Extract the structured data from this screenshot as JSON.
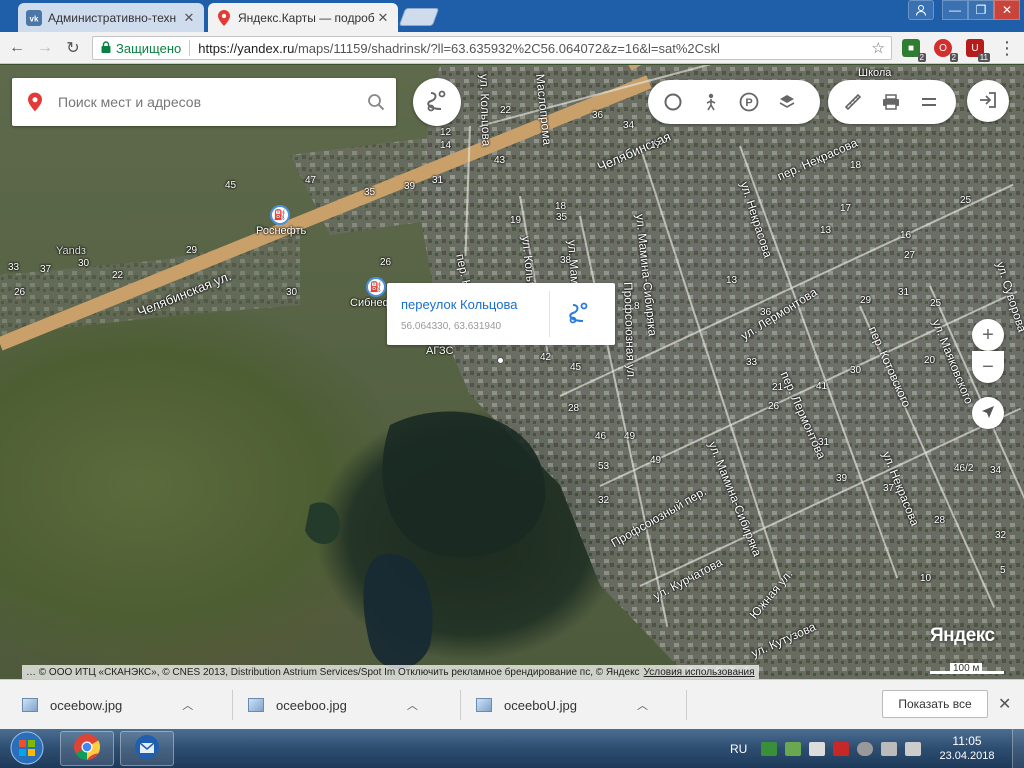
{
  "browser": {
    "tabs": [
      {
        "title": "Административно-техн",
        "favicon": "vk-icon",
        "active": false
      },
      {
        "title": "Яндекс.Карты — подроб",
        "favicon": "map-pin-icon",
        "active": true
      }
    ],
    "secure_label": "Защищено",
    "url_host": "https://yandex.ru",
    "url_path": "/maps/11159/shadrinsk/?ll=63.635932%2C56.064072&z=16&l=sat%2Cskl",
    "extensions": [
      {
        "name": "extension-green-icon",
        "badge": "2",
        "color": "#2e7d32"
      },
      {
        "name": "extension-opera-icon",
        "badge": "2",
        "color": "#d32f2f"
      },
      {
        "name": "extension-shield-icon",
        "badge": "11",
        "color": "#b71c1c"
      }
    ]
  },
  "map": {
    "search_placeholder": "Поиск мест и адресов",
    "popup": {
      "title": "переулок Кольцова",
      "coords": "56.064330, 63.631940"
    },
    "street_labels": {
      "chel_main": "Челябинская ул.",
      "chel_top": "Челябинская",
      "koltsova_top": "ул. Кольцова",
      "maslopromo": "Маслопрома",
      "koltsova_per": "пер. К",
      "koltsova_ul": "ул. Кольцо",
      "mamina_top": "ул. Мамин",
      "mamina_sib": "ул. Мамина-Сибиряка",
      "profsoyuznaya": "Профсоюзная ул.",
      "nekrasova_ul": "ул. Некрасова",
      "nekrasova_per": "пер. Некрасова",
      "lermontova_ul": "ул. Лермонтова",
      "lermontova_per": "пер. Лермонтова",
      "kotovskogo": "пер. Котовского",
      "mayakovskogo": "ул. Маяковского",
      "suvorova": "ул. Суворова",
      "nekrasova_low": "ул. Некрасова",
      "mamina_low": "ул. Мамина-Сибиряка",
      "profsoyuzny_per": "Профсоюзный пер.",
      "kurchatova": "ул. Курчатова",
      "yuzhnaya": "Южная ул.",
      "kutuzova": "ул. Кутузова",
      "shkola": "Школа"
    },
    "poi": {
      "rosneft": "Роснефть",
      "sibneft": "Сибнеф",
      "agzs": "АГЗС",
      "yandz": "Yandз"
    },
    "house_numbers": [
      "12",
      "14",
      "22",
      "43",
      "36",
      "34",
      "17",
      "14",
      "35",
      "39",
      "31",
      "47",
      "45",
      "29",
      "33",
      "37",
      "30",
      "22",
      "26",
      "30",
      "19",
      "18",
      "35",
      "26",
      "38",
      "42",
      "45",
      "28",
      "46",
      "49",
      "53",
      "32",
      "8",
      "13",
      "29",
      "36",
      "33",
      "41",
      "30",
      "31",
      "25",
      "27",
      "20",
      "21",
      "26",
      "31",
      "39",
      "37",
      "46/2",
      "34",
      "32",
      "28",
      "10",
      "5",
      "17",
      "13",
      "16",
      "25",
      "49",
      "18"
    ],
    "brand": "Яндекс",
    "scale": "100 м",
    "copyright": "… © ООО ИТЦ «СКАНЭКС», © CNES 2013, Distribution Astrium Services/Spot Im",
    "copyright_tail": "Отключить рекламное брендирование пс, © Яндекс",
    "terms": "Условия использования"
  },
  "downloads": {
    "items": [
      "oceebow.jpg",
      "oceeboo.jpg",
      "oceeboU.jpg"
    ],
    "show_all": "Показать все"
  },
  "taskbar": {
    "lang": "RU",
    "time": "11:05",
    "date": "23.04.2018"
  }
}
